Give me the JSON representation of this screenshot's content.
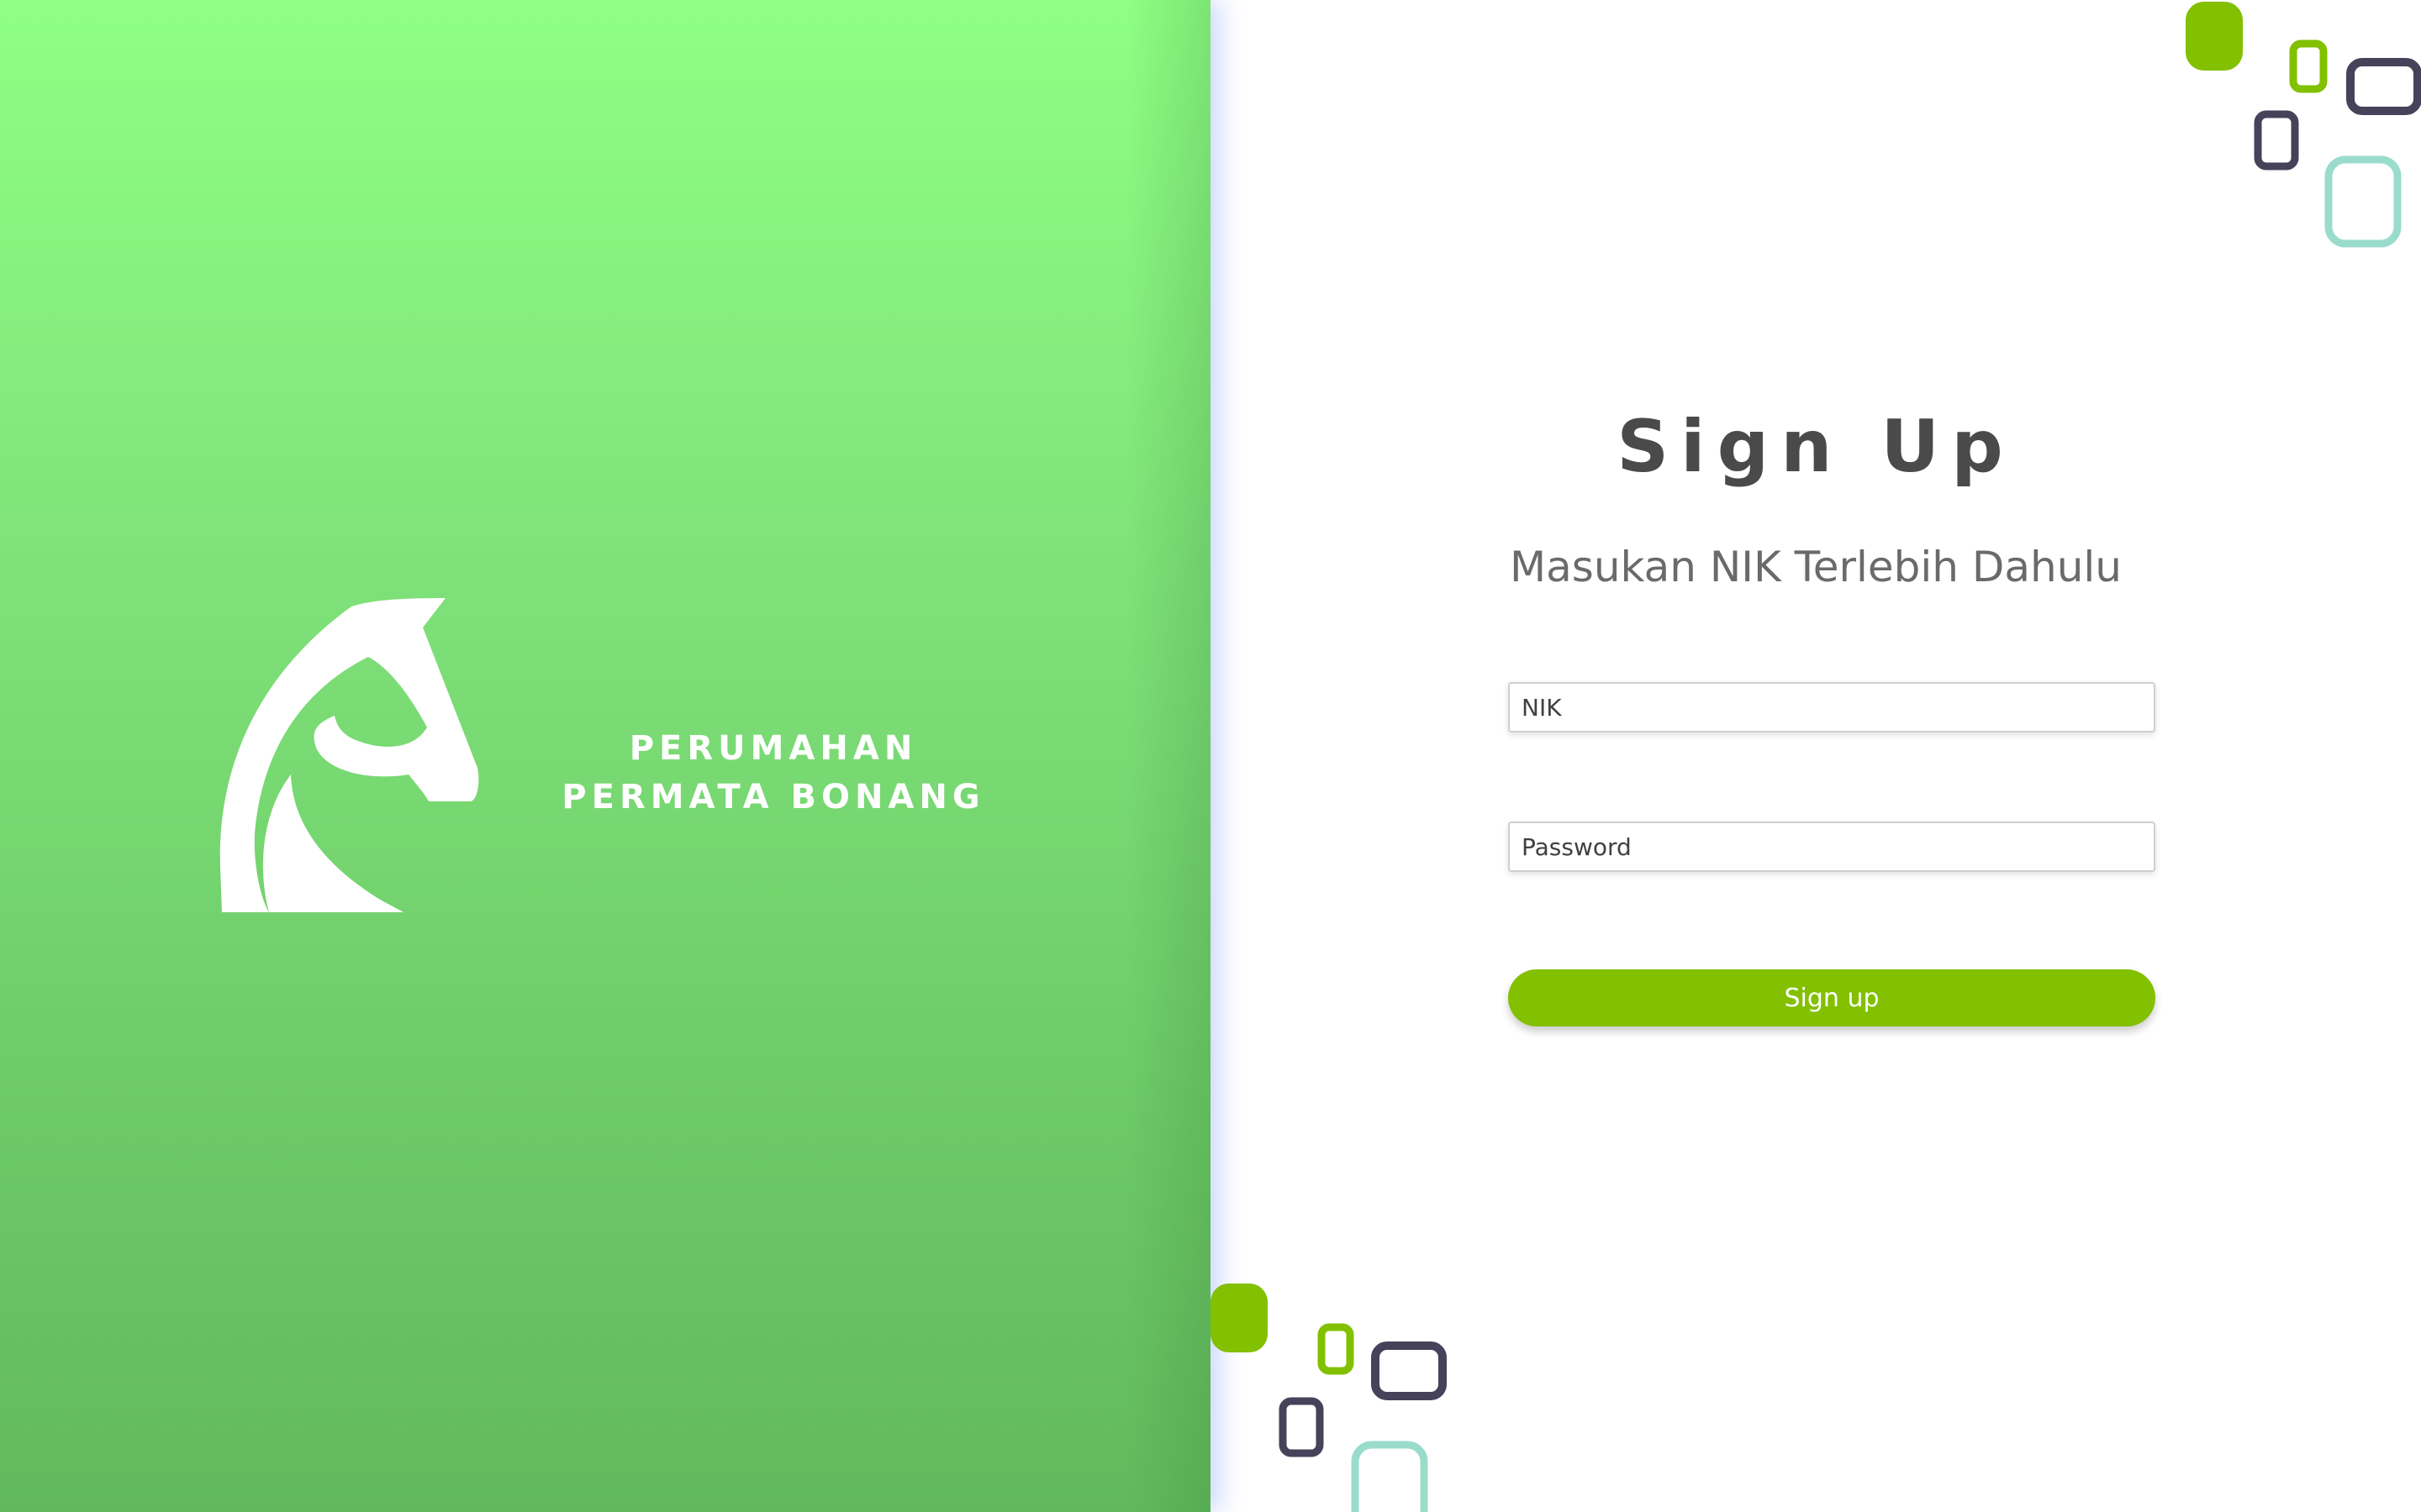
{
  "brand": {
    "logo_icon": "horse-head-icon",
    "line1": "PERUMAHAN",
    "line2": "PERMATA BONANG"
  },
  "form": {
    "title": "Sign Up",
    "subtitle": "Masukan NIK Terlebih Dahulu",
    "nik_placeholder": "NIK",
    "password_placeholder": "Password",
    "submit_label": "Sign up"
  },
  "colors": {
    "panel_green_top": "#8eff84",
    "panel_green_bottom": "#62b95d",
    "button_green": "#82c000",
    "deco_navy": "#45425a",
    "deco_teal": "#9adccb"
  }
}
